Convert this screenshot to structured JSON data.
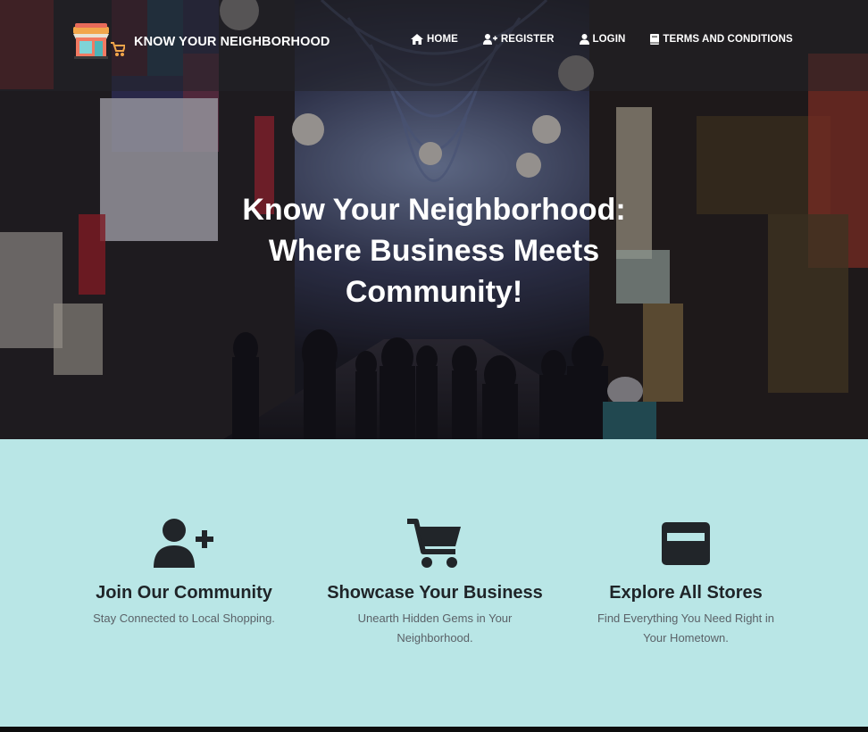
{
  "brand": {
    "name": "KNOW YOUR NEIGHBORHOOD",
    "logo_icon": "storefront-cart-icon"
  },
  "nav": {
    "items": [
      {
        "label": "HOME",
        "icon": "home-icon"
      },
      {
        "label": "REGISTER",
        "icon": "user-plus-icon"
      },
      {
        "label": "LOGIN",
        "icon": "user-icon"
      },
      {
        "label": "TERMS AND CONDITIONS",
        "icon": "book-icon"
      }
    ]
  },
  "hero": {
    "title_lines": [
      "Know Your Neighborhood:",
      "Where Business Meets",
      "Community!"
    ]
  },
  "features": [
    {
      "icon": "user-plus-icon",
      "title": "Join Our Community",
      "lines": [
        "Stay Connected to Local Shopping.",
        ""
      ]
    },
    {
      "icon": "shopping-cart-icon",
      "title": "Showcase Your Business",
      "lines": [
        "Unearth Hidden Gems in Your",
        "Neighborhood."
      ]
    },
    {
      "icon": "window-icon",
      "title": "Explore All Stores",
      "lines": [
        "Find Everything You Need Right in",
        "Your Hometown."
      ]
    }
  ],
  "colors": {
    "features_bg": "#b9e6e6",
    "icon_dark": "#212529",
    "text_white": "#ffffff"
  }
}
